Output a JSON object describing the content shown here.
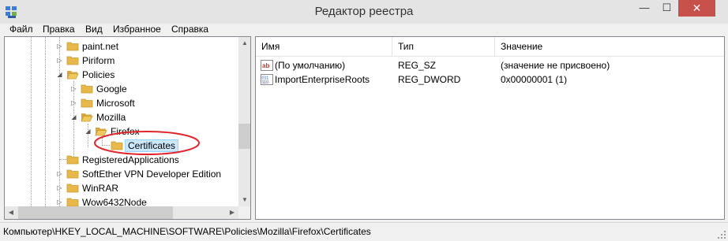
{
  "window": {
    "title": "Редактор реестра",
    "minimize_glyph": "—",
    "maximize_glyph": "☐",
    "close_glyph": "✕"
  },
  "menu": {
    "items": [
      "Файл",
      "Правка",
      "Вид",
      "Избранное",
      "Справка"
    ]
  },
  "tree": {
    "items": [
      {
        "label": "paint.net",
        "expanded": false
      },
      {
        "label": "Piriform",
        "expanded": false
      },
      {
        "label": "Policies",
        "expanded": true
      },
      {
        "label": "Google",
        "expanded": false
      },
      {
        "label": "Microsoft",
        "expanded": false
      },
      {
        "label": "Mozilla",
        "expanded": true
      },
      {
        "label": "Firefox",
        "expanded": true
      },
      {
        "label": "Certificates",
        "selected": true
      },
      {
        "label": "RegisteredApplications"
      },
      {
        "label": "SoftEther VPN Developer Edition",
        "expanded": false
      },
      {
        "label": "WinRAR",
        "expanded": false
      },
      {
        "label": "Wow6432Node",
        "expanded": false
      }
    ]
  },
  "list": {
    "columns": [
      "Имя",
      "Тип",
      "Значение"
    ],
    "rows": [
      {
        "icon": "string-value-icon",
        "name": "(По умолчанию)",
        "type": "REG_SZ",
        "data": "(значение не присвоено)"
      },
      {
        "icon": "binary-value-icon",
        "name": "ImportEnterpriseRoots",
        "type": "REG_DWORD",
        "data": "0x00000001 (1)"
      }
    ]
  },
  "status": {
    "path": "Компьютер\\HKEY_LOCAL_MACHINE\\SOFTWARE\\Policies\\Mozilla\\Firefox\\Certificates"
  },
  "colors": {
    "selection": "#cce8ff",
    "annotation": "#e0262b",
    "close_button": "#c7504b",
    "folder": "#e8b94a"
  }
}
